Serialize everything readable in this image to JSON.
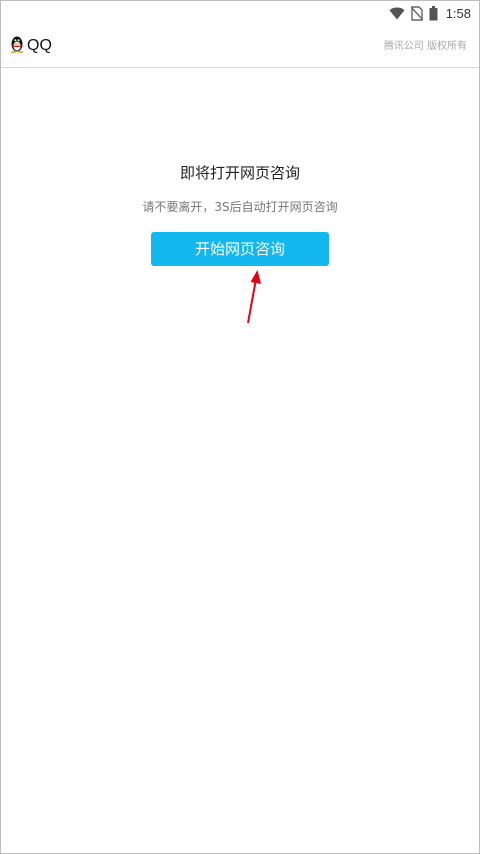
{
  "status_bar": {
    "time": "1:58",
    "icons": [
      "wifi-icon",
      "no-sim-icon",
      "battery-icon"
    ]
  },
  "header": {
    "app_name": "QQ",
    "logo_icon": "qq-penguin-icon",
    "copyright": "腾讯公司 版权所有"
  },
  "main": {
    "title": "即将打开网页咨询",
    "subtitle": "请不要离开，3S后自动打开网页咨询",
    "button_label": "开始网页咨询"
  },
  "colors": {
    "button": "#14b8f0",
    "arrow": "#e60012"
  }
}
